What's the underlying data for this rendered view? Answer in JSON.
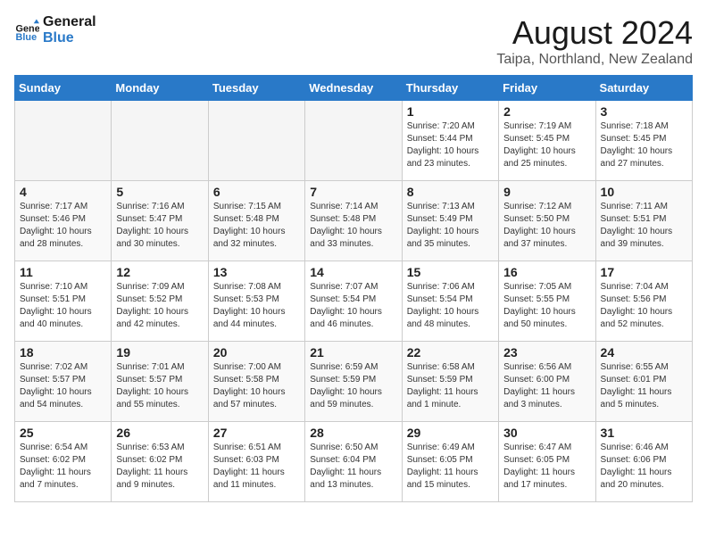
{
  "header": {
    "logo_general": "General",
    "logo_blue": "Blue",
    "month_title": "August 2024",
    "location": "Taipa, Northland, New Zealand"
  },
  "weekdays": [
    "Sunday",
    "Monday",
    "Tuesday",
    "Wednesday",
    "Thursday",
    "Friday",
    "Saturday"
  ],
  "weeks": [
    [
      {
        "day": "",
        "empty": true
      },
      {
        "day": "",
        "empty": true
      },
      {
        "day": "",
        "empty": true
      },
      {
        "day": "",
        "empty": true
      },
      {
        "day": "1",
        "sunrise": "7:20 AM",
        "sunset": "5:44 PM",
        "daylight": "10 hours and 23 minutes."
      },
      {
        "day": "2",
        "sunrise": "7:19 AM",
        "sunset": "5:45 PM",
        "daylight": "10 hours and 25 minutes."
      },
      {
        "day": "3",
        "sunrise": "7:18 AM",
        "sunset": "5:45 PM",
        "daylight": "10 hours and 27 minutes."
      }
    ],
    [
      {
        "day": "4",
        "sunrise": "7:17 AM",
        "sunset": "5:46 PM",
        "daylight": "10 hours and 28 minutes."
      },
      {
        "day": "5",
        "sunrise": "7:16 AM",
        "sunset": "5:47 PM",
        "daylight": "10 hours and 30 minutes."
      },
      {
        "day": "6",
        "sunrise": "7:15 AM",
        "sunset": "5:48 PM",
        "daylight": "10 hours and 32 minutes."
      },
      {
        "day": "7",
        "sunrise": "7:14 AM",
        "sunset": "5:48 PM",
        "daylight": "10 hours and 33 minutes."
      },
      {
        "day": "8",
        "sunrise": "7:13 AM",
        "sunset": "5:49 PM",
        "daylight": "10 hours and 35 minutes."
      },
      {
        "day": "9",
        "sunrise": "7:12 AM",
        "sunset": "5:50 PM",
        "daylight": "10 hours and 37 minutes."
      },
      {
        "day": "10",
        "sunrise": "7:11 AM",
        "sunset": "5:51 PM",
        "daylight": "10 hours and 39 minutes."
      }
    ],
    [
      {
        "day": "11",
        "sunrise": "7:10 AM",
        "sunset": "5:51 PM",
        "daylight": "10 hours and 40 minutes."
      },
      {
        "day": "12",
        "sunrise": "7:09 AM",
        "sunset": "5:52 PM",
        "daylight": "10 hours and 42 minutes."
      },
      {
        "day": "13",
        "sunrise": "7:08 AM",
        "sunset": "5:53 PM",
        "daylight": "10 hours and 44 minutes."
      },
      {
        "day": "14",
        "sunrise": "7:07 AM",
        "sunset": "5:54 PM",
        "daylight": "10 hours and 46 minutes."
      },
      {
        "day": "15",
        "sunrise": "7:06 AM",
        "sunset": "5:54 PM",
        "daylight": "10 hours and 48 minutes."
      },
      {
        "day": "16",
        "sunrise": "7:05 AM",
        "sunset": "5:55 PM",
        "daylight": "10 hours and 50 minutes."
      },
      {
        "day": "17",
        "sunrise": "7:04 AM",
        "sunset": "5:56 PM",
        "daylight": "10 hours and 52 minutes."
      }
    ],
    [
      {
        "day": "18",
        "sunrise": "7:02 AM",
        "sunset": "5:57 PM",
        "daylight": "10 hours and 54 minutes."
      },
      {
        "day": "19",
        "sunrise": "7:01 AM",
        "sunset": "5:57 PM",
        "daylight": "10 hours and 55 minutes."
      },
      {
        "day": "20",
        "sunrise": "7:00 AM",
        "sunset": "5:58 PM",
        "daylight": "10 hours and 57 minutes."
      },
      {
        "day": "21",
        "sunrise": "6:59 AM",
        "sunset": "5:59 PM",
        "daylight": "10 hours and 59 minutes."
      },
      {
        "day": "22",
        "sunrise": "6:58 AM",
        "sunset": "5:59 PM",
        "daylight": "11 hours and 1 minute."
      },
      {
        "day": "23",
        "sunrise": "6:56 AM",
        "sunset": "6:00 PM",
        "daylight": "11 hours and 3 minutes."
      },
      {
        "day": "24",
        "sunrise": "6:55 AM",
        "sunset": "6:01 PM",
        "daylight": "11 hours and 5 minutes."
      }
    ],
    [
      {
        "day": "25",
        "sunrise": "6:54 AM",
        "sunset": "6:02 PM",
        "daylight": "11 hours and 7 minutes."
      },
      {
        "day": "26",
        "sunrise": "6:53 AM",
        "sunset": "6:02 PM",
        "daylight": "11 hours and 9 minutes."
      },
      {
        "day": "27",
        "sunrise": "6:51 AM",
        "sunset": "6:03 PM",
        "daylight": "11 hours and 11 minutes."
      },
      {
        "day": "28",
        "sunrise": "6:50 AM",
        "sunset": "6:04 PM",
        "daylight": "11 hours and 13 minutes."
      },
      {
        "day": "29",
        "sunrise": "6:49 AM",
        "sunset": "6:05 PM",
        "daylight": "11 hours and 15 minutes."
      },
      {
        "day": "30",
        "sunrise": "6:47 AM",
        "sunset": "6:05 PM",
        "daylight": "11 hours and 17 minutes."
      },
      {
        "day": "31",
        "sunrise": "6:46 AM",
        "sunset": "6:06 PM",
        "daylight": "11 hours and 20 minutes."
      }
    ]
  ],
  "labels": {
    "sunrise_prefix": "Sunrise: ",
    "sunset_prefix": "Sunset: ",
    "daylight_prefix": "Daylight: "
  }
}
